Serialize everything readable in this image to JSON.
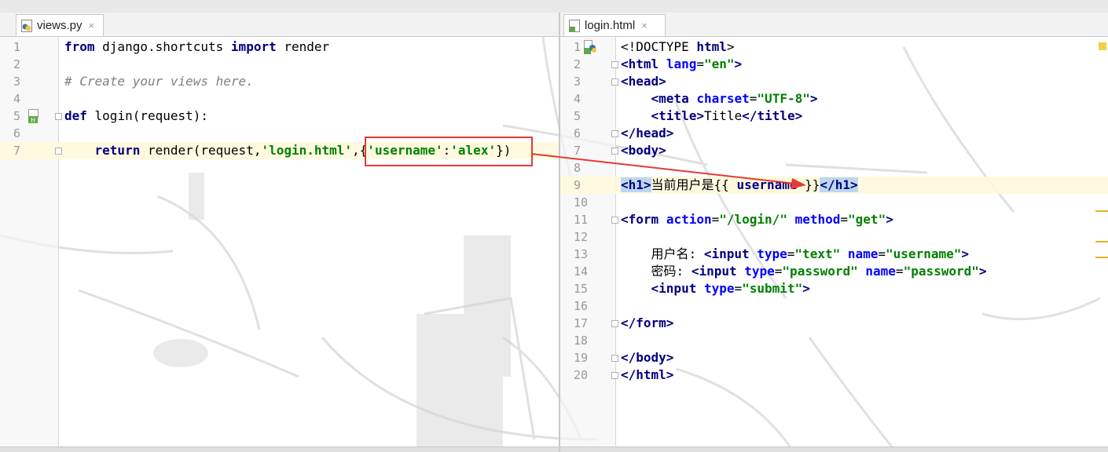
{
  "left_tab": {
    "label": "views.py",
    "close": "×",
    "icon": "python-file-icon"
  },
  "right_tab": {
    "label": "login.html",
    "close": "×",
    "icon": "html-file-icon"
  },
  "left_lines": [
    {
      "n": "1",
      "text": "from django.shortcuts import render"
    },
    {
      "n": "2",
      "text": ""
    },
    {
      "n": "3",
      "text": "# Create your views here."
    },
    {
      "n": "4",
      "text": ""
    },
    {
      "n": "5",
      "text": "def login(request):"
    },
    {
      "n": "6",
      "text": ""
    },
    {
      "n": "7",
      "text": "    return render(request,'login.html',{'username':'alex'})"
    }
  ],
  "right_lines": [
    {
      "n": "1",
      "text": "<!DOCTYPE html>"
    },
    {
      "n": "2",
      "text": "<html lang=\"en\">"
    },
    {
      "n": "3",
      "text": "<head>"
    },
    {
      "n": "4",
      "text": "    <meta charset=\"UTF-8\">"
    },
    {
      "n": "5",
      "text": "    <title>Title</title>"
    },
    {
      "n": "6",
      "text": "</head>"
    },
    {
      "n": "7",
      "text": "<body>"
    },
    {
      "n": "8",
      "text": ""
    },
    {
      "n": "9",
      "text": "<h1>当前用户是{{ username }}</h1>"
    },
    {
      "n": "10",
      "text": ""
    },
    {
      "n": "11",
      "text": "<form action=\"/login/\" method=\"get\">"
    },
    {
      "n": "12",
      "text": ""
    },
    {
      "n": "13",
      "text": "    用户名: <input type=\"text\" name=\"username\">"
    },
    {
      "n": "14",
      "text": "    密码: <input type=\"password\" name=\"password\">"
    },
    {
      "n": "15",
      "text": "    <input type=\"submit\">"
    },
    {
      "n": "16",
      "text": ""
    },
    {
      "n": "17",
      "text": "</form>"
    },
    {
      "n": "18",
      "text": ""
    },
    {
      "n": "19",
      "text": "</body>"
    },
    {
      "n": "20",
      "text": "</html>"
    }
  ],
  "colors": {
    "annotation": "#e53935",
    "keyword": "#000080",
    "string": "#008000",
    "comment": "#808080"
  }
}
